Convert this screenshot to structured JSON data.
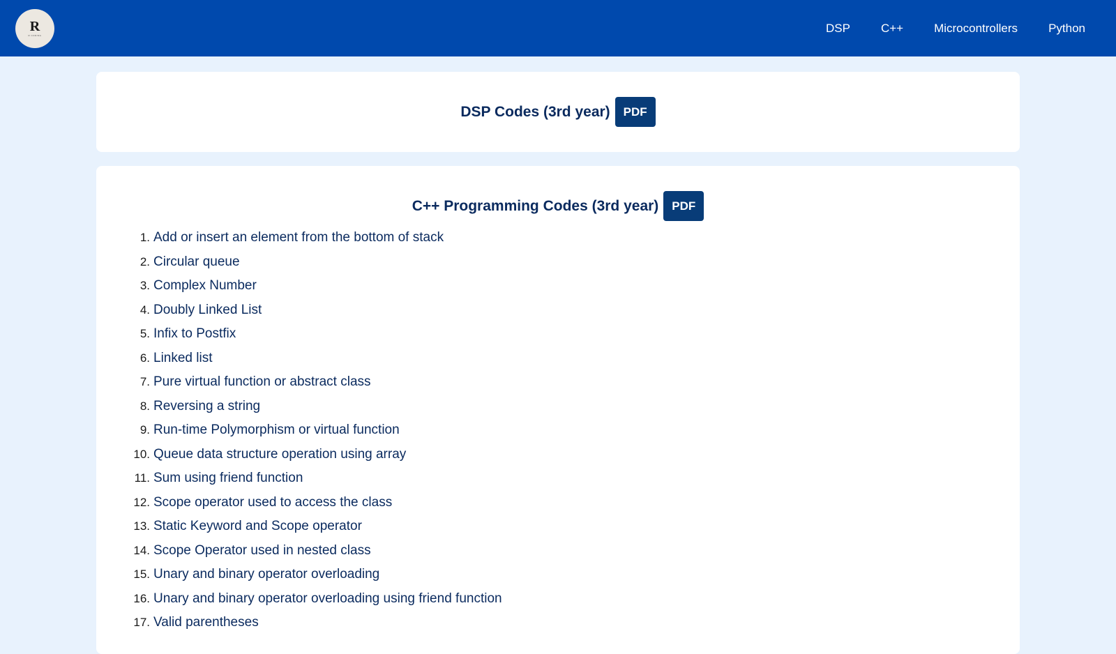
{
  "nav": {
    "logo": {
      "letter": "R",
      "sub": "R CODING"
    },
    "links": [
      "DSP",
      "C++",
      "Microcontrollers",
      "Python"
    ]
  },
  "dsp_section": {
    "title": "DSP Codes (3rd year)",
    "pdf_label": "PDF"
  },
  "cpp_section": {
    "title": "C++ Programming Codes (3rd year)",
    "pdf_label": "PDF",
    "items": [
      "Add or insert an element from the bottom of stack",
      "Circular queue",
      "Complex Number",
      "Doubly Linked List",
      "Infix to Postfix",
      "Linked list",
      "Pure virtual function or abstract class",
      "Reversing a string",
      "Run-time Polymorphism or virtual function",
      "Queue data structure operation using array",
      "Sum using friend function",
      "Scope operator used to access the class",
      "Static Keyword and Scope operator",
      "Scope Operator used in nested class",
      "Unary and binary operator overloading",
      "Unary and binary operator overloading using friend function",
      "Valid parentheses"
    ]
  },
  "colors": {
    "navbar": "#0049ad",
    "background": "#e8f2fd",
    "pdf_button": "#083c78",
    "text": "#0a2a5e"
  }
}
